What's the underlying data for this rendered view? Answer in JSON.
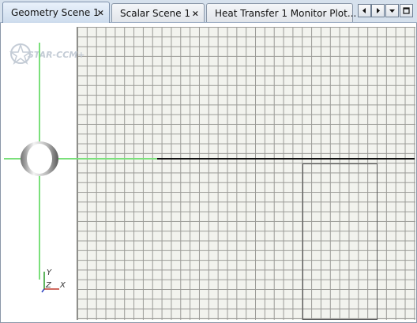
{
  "tabs": [
    {
      "label": "Geometry Scene 1",
      "closable": true,
      "active": true
    },
    {
      "label": "Scalar Scene 1",
      "closable": true,
      "active": false
    },
    {
      "label": "Heat Transfer 1 Monitor Plot...",
      "closable": false,
      "active": false
    }
  ],
  "close_glyph": "×",
  "nav": {
    "left_icon": "arrow-left-icon",
    "right_icon": "arrow-right-icon",
    "menu_icon": "dropdown-menu-icon",
    "maximize_icon": "maximize-icon"
  },
  "logo_text": "STAR-CCM+",
  "axes": {
    "y": "Y",
    "z": "Z",
    "x": "X"
  },
  "colors": {
    "tab_bar": "#d6e1ed",
    "grid_background": "#f2f3ee",
    "grid_lines": "#9a9a96",
    "axis_green": "#7be07b",
    "black_line": "#111111"
  }
}
